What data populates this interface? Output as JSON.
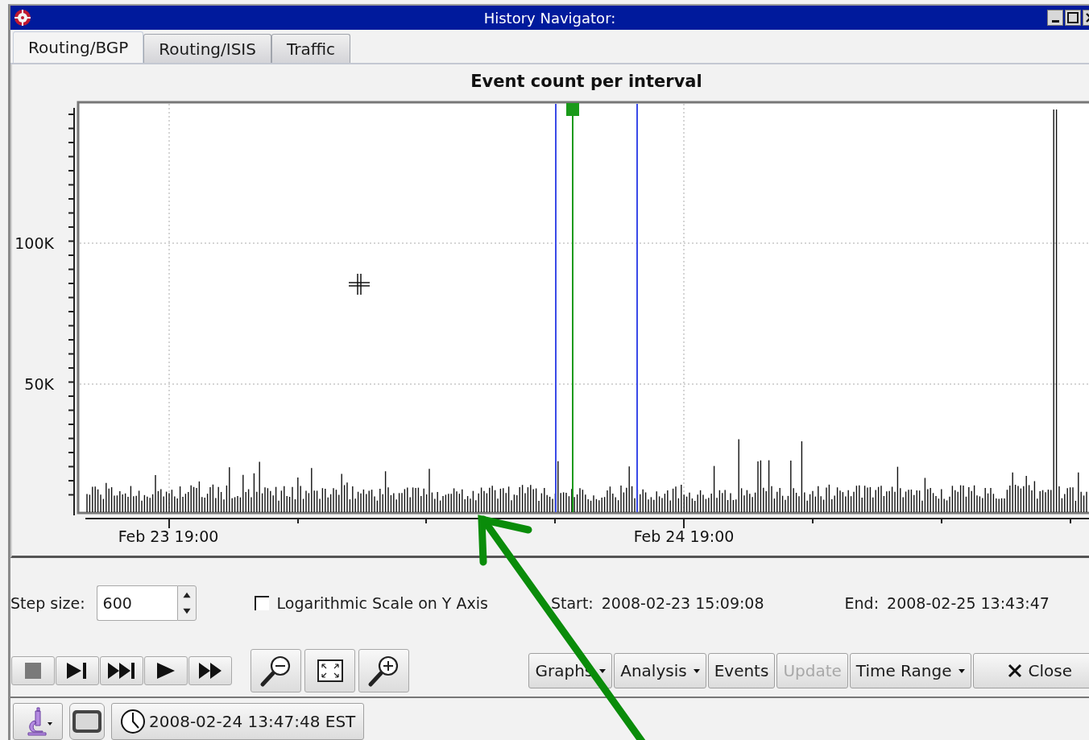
{
  "window": {
    "title": "History Navigator:"
  },
  "tabs": [
    {
      "label": "Routing/BGP",
      "selected": true
    },
    {
      "label": "Routing/ISIS",
      "selected": false
    },
    {
      "label": "Traffic",
      "selected": false
    }
  ],
  "chart": {
    "title": "Event count per interval",
    "y_labels": [
      "100K",
      "50K"
    ],
    "x_labels": [
      "Feb 23 19:00",
      "Feb 24 19:00"
    ]
  },
  "step_size": {
    "label": "Step size:",
    "value": "600"
  },
  "log_scale": {
    "label": "Logarithmic Scale on Y Axis",
    "checked": false
  },
  "start": {
    "label": "Start:",
    "value": "2008-02-23 15:09:08"
  },
  "end": {
    "label": "End:",
    "value": "2008-02-25 13:43:47"
  },
  "playback_buttons": [
    {
      "kind": "stop"
    },
    {
      "kind": "step"
    },
    {
      "kind": "skip"
    },
    {
      "kind": "play"
    },
    {
      "kind": "fast"
    }
  ],
  "zoom_buttons": [
    {
      "kind": "zoom-out"
    },
    {
      "kind": "fit"
    },
    {
      "kind": "zoom-in"
    }
  ],
  "action_buttons": [
    {
      "label": "Graphs",
      "dropdown": true,
      "disabled": false,
      "kind": "text"
    },
    {
      "label": "Analysis",
      "dropdown": true,
      "disabled": false,
      "kind": "text"
    },
    {
      "label": "Events",
      "dropdown": false,
      "disabled": false,
      "kind": "text"
    },
    {
      "label": "Update",
      "dropdown": false,
      "disabled": true,
      "kind": "text"
    },
    {
      "label": "Time Range",
      "dropdown": true,
      "disabled": false,
      "kind": "text"
    },
    {
      "label": "Close",
      "dropdown": false,
      "disabled": false,
      "kind": "close"
    }
  ],
  "status": {
    "timestamp": "2008-02-24 13:47:48 EST"
  }
}
